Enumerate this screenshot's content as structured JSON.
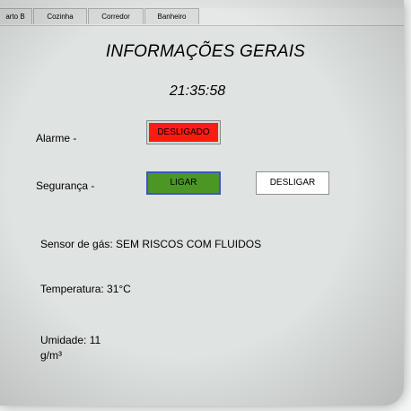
{
  "tabs": [
    "arto B",
    "Cozinha",
    "Corredor",
    "Banheiro"
  ],
  "title": "INFORMAÇÕES GERAIS",
  "clock": "21:35:58",
  "alarm": {
    "label": "Alarme -",
    "button": "DESLIGADO",
    "color": "#ff1a12"
  },
  "security": {
    "label": "Segurança -",
    "on_button": "LIGAR",
    "on_color": "#4b9624",
    "off_button": "DESLIGAR"
  },
  "sensors": {
    "gas": "Sensor de gás: SEM RISCOS COM FLUIDOS",
    "temperature": "Temperatura: 31°C",
    "humidity_line1": "Umidade: 11",
    "humidity_line2": "g/m³"
  }
}
